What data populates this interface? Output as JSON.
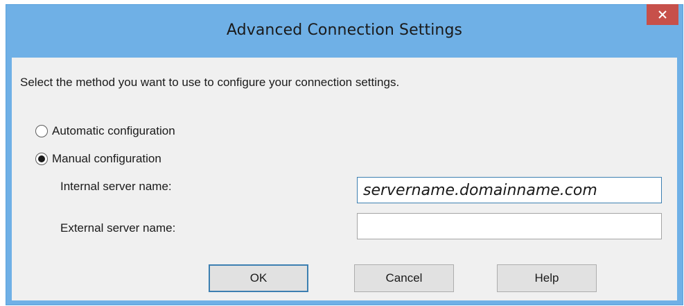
{
  "window": {
    "title": "Advanced Connection Settings",
    "close_icon": "close-icon"
  },
  "dialog": {
    "instructions": "Select the method you want to use to configure your connection settings.",
    "options": [
      {
        "label": "Automatic configuration",
        "selected": false
      },
      {
        "label": "Manual configuration",
        "selected": true
      }
    ],
    "internal_label": "Internal server name:",
    "internal_value": "servername.domainname.com",
    "external_label": "External server name:",
    "external_value": ""
  },
  "buttons": {
    "ok": "OK",
    "cancel": "Cancel",
    "help": "Help"
  },
  "colors": {
    "frame": "#6fb0e6",
    "close": "#c7504a",
    "focus": "#3c7fb1",
    "client": "#f0f0f0"
  }
}
